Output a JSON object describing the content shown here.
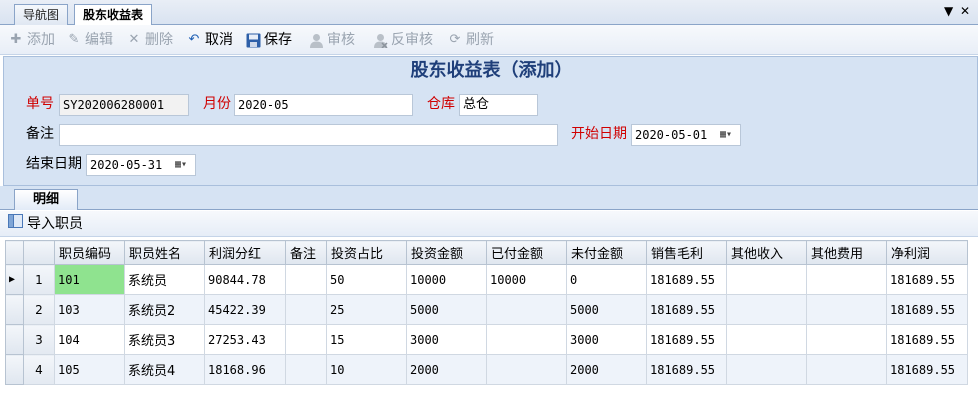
{
  "tabs": {
    "inactive": "导航图",
    "active": "股东收益表",
    "dropdown_glyph": "▼",
    "close_glyph": "✕"
  },
  "toolbar": {
    "add": "添加",
    "edit": "编辑",
    "delete": "删除",
    "cancel": "取消",
    "save": "保存",
    "audit": "审核",
    "unaudit": "反审核",
    "refresh": "刷新"
  },
  "form": {
    "title": "股东收益表（添加）",
    "order_no_label": "单号",
    "order_no": "SY202006280001",
    "month_label": "月份",
    "month": "2020-05",
    "warehouse_label": "仓库",
    "warehouse": "总仓",
    "remark_label": "备注",
    "remark": "",
    "start_date_label": "开始日期",
    "start_date": "2020-05-01",
    "end_date_label": "结束日期",
    "end_date": "2020-05-31"
  },
  "detail": {
    "tab_label": "明细",
    "import_label": "导入职员"
  },
  "grid": {
    "columns": [
      "职员编码",
      "职员姓名",
      "利润分红",
      "备注",
      "投资占比",
      "投资金额",
      "已付金额",
      "未付金额",
      "销售毛利",
      "其他收入",
      "其他费用",
      "净利润"
    ],
    "rows": [
      {
        "n": "1",
        "code": "101",
        "name": "系统员",
        "dividend": "90844.78",
        "remark": "",
        "ratio": "50",
        "invest": "10000",
        "paid": "10000",
        "unpaid": "0",
        "gross": "181689.55",
        "other_in": "",
        "other_fee": "",
        "net": "181689.55"
      },
      {
        "n": "2",
        "code": "103",
        "name": "系统员2",
        "dividend": "45422.39",
        "remark": "",
        "ratio": "25",
        "invest": "5000",
        "paid": "",
        "unpaid": "5000",
        "gross": "181689.55",
        "other_in": "",
        "other_fee": "",
        "net": "181689.55"
      },
      {
        "n": "3",
        "code": "104",
        "name": "系统员3",
        "dividend": "27253.43",
        "remark": "",
        "ratio": "15",
        "invest": "3000",
        "paid": "",
        "unpaid": "3000",
        "gross": "181689.55",
        "other_in": "",
        "other_fee": "",
        "net": "181689.55"
      },
      {
        "n": "4",
        "code": "105",
        "name": "系统员4",
        "dividend": "18168.96",
        "remark": "",
        "ratio": "10",
        "invest": "2000",
        "paid": "",
        "unpaid": "2000",
        "gross": "181689.55",
        "other_in": "",
        "other_fee": "",
        "net": "181689.55"
      }
    ]
  },
  "colors": {
    "selected_cell": "#8fe38f",
    "required_label": "#d00000",
    "title": "#1f3f7a"
  }
}
